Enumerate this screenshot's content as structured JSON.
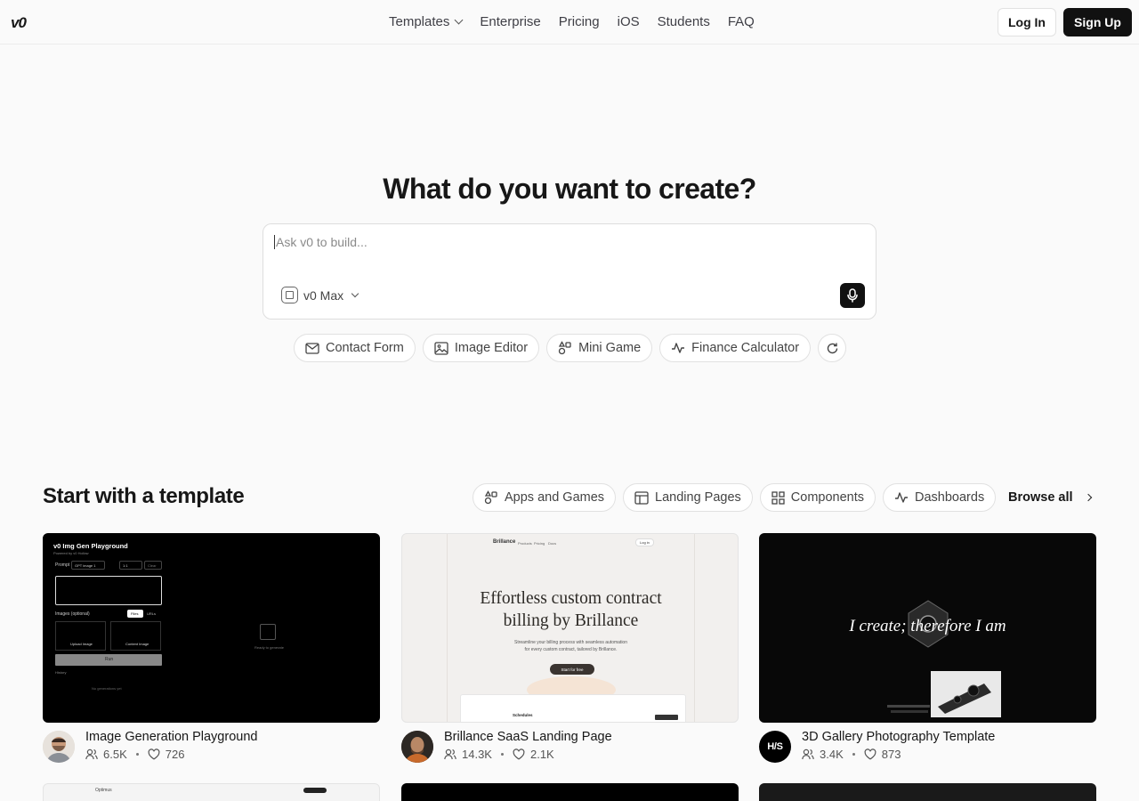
{
  "header": {
    "logo": "v0",
    "nav": [
      "Templates",
      "Enterprise",
      "Pricing",
      "iOS",
      "Students",
      "FAQ"
    ],
    "login": "Log In",
    "signup": "Sign Up"
  },
  "hero": {
    "title": "What do you want to create?",
    "placeholder": "Ask v0 to build...",
    "model": "v0 Max",
    "suggestions": [
      {
        "label": "Contact Form",
        "icon": "mail-icon"
      },
      {
        "label": "Image Editor",
        "icon": "image-icon"
      },
      {
        "label": "Mini Game",
        "icon": "shapes-icon"
      },
      {
        "label": "Finance Calculator",
        "icon": "activity-icon"
      }
    ]
  },
  "templates": {
    "title": "Start with a template",
    "filters": [
      {
        "label": "Apps and Games",
        "icon": "shapes-icon"
      },
      {
        "label": "Landing Pages",
        "icon": "layout-icon"
      },
      {
        "label": "Components",
        "icon": "grid-icon"
      },
      {
        "label": "Dashboards",
        "icon": "activity-icon"
      }
    ],
    "browse": "Browse all",
    "cards": [
      {
        "name": "Image Generation Playground",
        "users": "6.5K",
        "likes": "726",
        "thumb": {
          "heading": "v0 Img Gen Playground",
          "sub": "Powered by v0 Hollow",
          "prompt": "Prompt",
          "model": "GPT image 1",
          "ratio": "1:1",
          "clear": "Clear",
          "images": "Images (optional)",
          "file": "Files",
          "urls": "URLs",
          "upload": "Upload Image",
          "content": "Content Image",
          "run": "Run",
          "history": "History",
          "empty": "No generations yet",
          "ready": "Ready to generate"
        }
      },
      {
        "name": "Brillance SaaS Landing Page",
        "users": "14.3K",
        "likes": "2.1K",
        "thumb": {
          "brand": "Brillance",
          "links": [
            "Products",
            "Pricing",
            "Docs"
          ],
          "login": "Log in",
          "headline1": "Effortless custom contract",
          "headline2": "billing by Brillance",
          "sub1": "Streamline your billing process with seamless automation",
          "sub2": "for every custom contract, tailored by Brillance.",
          "cta": "Start for free",
          "panel_title": "Schedules"
        }
      },
      {
        "name": "3D Gallery Photography Template",
        "users": "3.4K",
        "likes": "873",
        "avatar_text": "H/S",
        "thumb": {
          "tagline": "I create; therefore I am"
        }
      }
    ],
    "row2": {
      "brand": "Optimus"
    }
  }
}
